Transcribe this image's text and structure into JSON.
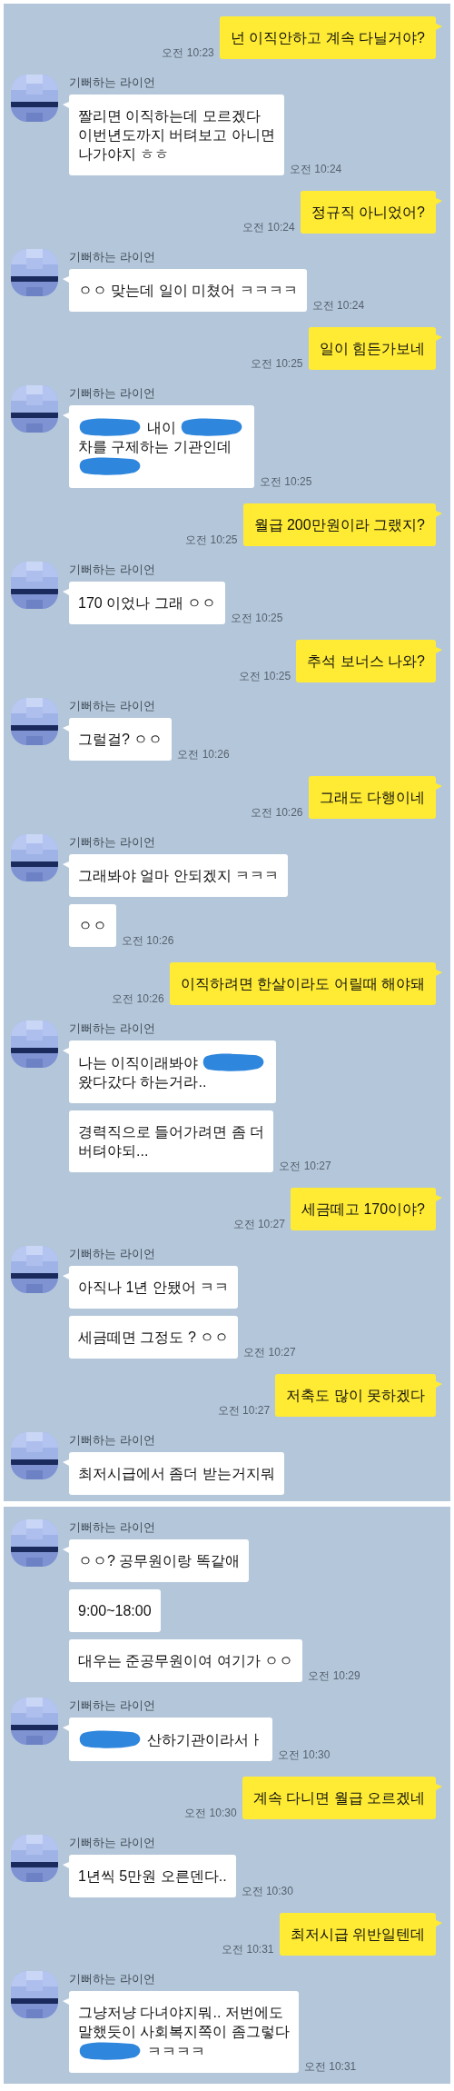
{
  "panels": [
    {
      "messages": [
        {
          "kind": "sent",
          "text": "넌 이직안하고 계속 다닐거야?",
          "time": "오전 10:23"
        },
        {
          "kind": "received",
          "sender": "기뻐하는 라이언",
          "bubbles": [
            {
              "text": "짤리면 이직하는데 모르겠다\n이번년도까지 버텨보고 아니면\n나가야지 ㅎㅎ"
            }
          ],
          "time": "오전 10:24"
        },
        {
          "kind": "sent",
          "text": "정규직 아니었어?",
          "time": "오전 10:24"
        },
        {
          "kind": "received",
          "sender": "기뻐하는 라이언",
          "bubbles": [
            {
              "text": "ㅇㅇ 맞는데 일이 미쳤어 ㅋㅋㅋㅋ"
            }
          ],
          "time": "오전 10:24"
        },
        {
          "kind": "sent",
          "text": "일이 힘든가보네",
          "time": "오전 10:25"
        },
        {
          "kind": "received",
          "sender": "기뻐하는 라이언",
          "bubbles": [
            {
              "lines": [
                [
                  {
                    "kind": "redaction"
                  },
                  {
                    "kind": "text",
                    "text": "내이"
                  },
                  {
                    "kind": "redaction"
                  }
                ],
                [
                  {
                    "kind": "text",
                    "text": "차를 구제하는 기관인데"
                  }
                ],
                [
                  {
                    "kind": "redaction"
                  }
                ]
              ]
            }
          ],
          "time": "오전 10:25"
        },
        {
          "kind": "sent",
          "text": "월급 200만원이라 그랬지?",
          "time": "오전 10:25"
        },
        {
          "kind": "received",
          "sender": "기뻐하는 라이언",
          "bubbles": [
            {
              "text": "170 이었나 그래 ㅇㅇ"
            }
          ],
          "time": "오전 10:25"
        },
        {
          "kind": "sent",
          "text": "추석 보너스 나와?",
          "time": "오전 10:25"
        },
        {
          "kind": "received",
          "sender": "기뻐하는 라이언",
          "bubbles": [
            {
              "text": "그럴걸? ㅇㅇ"
            }
          ],
          "time": "오전 10:26"
        },
        {
          "kind": "sent",
          "text": "그래도 다행이네",
          "time": "오전 10:26"
        },
        {
          "kind": "received",
          "sender": "기뻐하는 라이언",
          "bubbles": [
            {
              "text": "그래봐야 얼마 안되겠지 ㅋㅋㅋ"
            },
            {
              "text": "ㅇㅇ"
            }
          ],
          "time": "오전 10:26"
        },
        {
          "kind": "sent",
          "text": "이직하려면 한살이라도 어릴때 해야돼",
          "time": "오전 10:26"
        },
        {
          "kind": "received",
          "sender": "기뻐하는 라이언",
          "bubbles": [
            {
              "lines": [
                [
                  {
                    "kind": "text",
                    "text": "나는 이직이래봐야"
                  },
                  {
                    "kind": "redaction"
                  }
                ],
                [
                  {
                    "kind": "text",
                    "text": "왔다갔다 하는거라.."
                  }
                ]
              ]
            },
            {
              "text": "경력직으로 들어가려면 좀 더\n버텨야되..."
            }
          ],
          "time": "오전 10:27"
        },
        {
          "kind": "sent",
          "text": "세금떼고 170이야?",
          "time": "오전 10:27"
        },
        {
          "kind": "received",
          "sender": "기뻐하는 라이언",
          "bubbles": [
            {
              "text": "아직나 1년 안됐어 ㅋㅋ"
            },
            {
              "text": "세금떼면 그정도 ? ㅇㅇ"
            }
          ],
          "time": "오전 10:27"
        },
        {
          "kind": "sent",
          "text": "저축도 많이 못하겠다",
          "time": "오전 10:27"
        },
        {
          "kind": "received",
          "sender": "기뻐하는 라이언",
          "bubbles": [
            {
              "text": "최저시급에서 좀더 받는거지뭐"
            }
          ]
        }
      ]
    },
    {
      "messages": [
        {
          "kind": "received",
          "sender": "기뻐하는 라이언",
          "bubbles": [
            {
              "text": "ㅇㅇ? 공무원이랑 똑같애"
            },
            {
              "text": "9:00~18:00"
            },
            {
              "text": "대우는 준공무원이여 여기가 ㅇㅇ"
            }
          ],
          "time": "오전 10:29"
        },
        {
          "kind": "received",
          "sender": "기뻐하는 라이언",
          "bubbles": [
            {
              "lines": [
                [
                  {
                    "kind": "redaction"
                  },
                  {
                    "kind": "text",
                    "text": "산하기관이라서ㅏ"
                  }
                ]
              ]
            }
          ],
          "time": "오전 10:30"
        },
        {
          "kind": "sent",
          "text": "계속 다니면 월급 오르겠네",
          "time": "오전 10:30"
        },
        {
          "kind": "received",
          "sender": "기뻐하는 라이언",
          "bubbles": [
            {
              "text": "1년씩 5만원 오른덴다.."
            }
          ],
          "time": "오전 10:30"
        },
        {
          "kind": "sent",
          "text": "최저시급 위반일텐데",
          "time": "오전 10:31"
        },
        {
          "kind": "received",
          "sender": "기뻐하는 라이언",
          "bubbles": [
            {
              "lines": [
                [
                  {
                    "kind": "text",
                    "text": "그냥저냥 다녀야지뭐.. 저번에도"
                  }
                ],
                [
                  {
                    "kind": "text",
                    "text": "말했듯이 사회복지쪽이 좀그렇다"
                  }
                ],
                [
                  {
                    "kind": "redaction"
                  },
                  {
                    "kind": "text",
                    "text": "ㅋㅋㅋㅋ"
                  }
                ]
              ]
            }
          ],
          "time": "오전 10:31"
        }
      ]
    }
  ]
}
